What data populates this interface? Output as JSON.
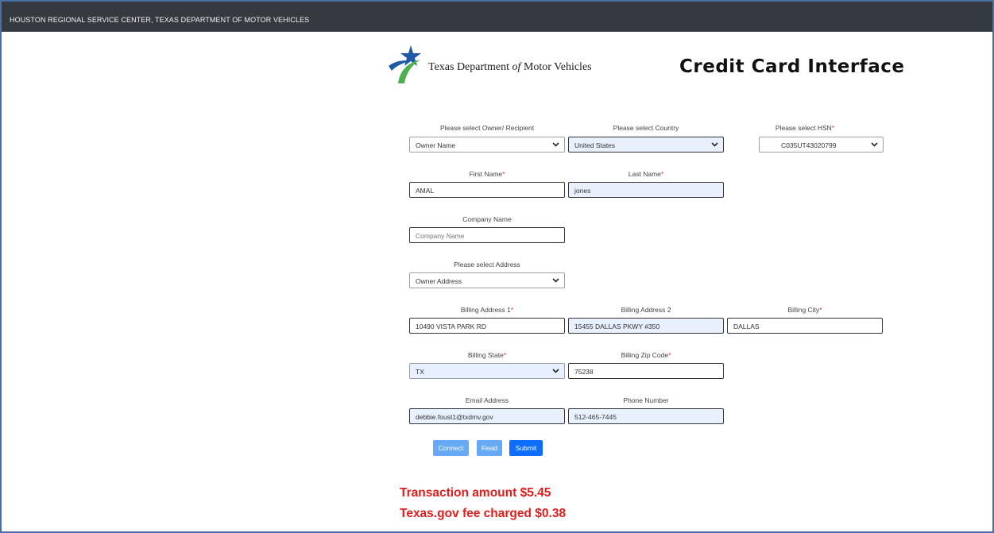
{
  "header": {
    "title": "HOUSTON REGIONAL SERVICE CENTER, TEXAS DEPARTMENT OF MOTOR VEHICLES"
  },
  "brand": {
    "logo_prefix": "Texas Department ",
    "logo_of": "of",
    "logo_suffix": " Motor Vehicles"
  },
  "page": {
    "title": "Credit Card Interface"
  },
  "form": {
    "owner": {
      "label": "Please select Owner/ Recipient",
      "value": "Owner Name"
    },
    "country": {
      "label": "Please select Country",
      "value": "United States"
    },
    "hsn": {
      "label": "Please select HSN",
      "value": "C035UT43020799"
    },
    "first_name": {
      "label": "First Name",
      "value": "AMAL"
    },
    "last_name": {
      "label": "Last Name",
      "value": "jones"
    },
    "company": {
      "label": "Company Name",
      "placeholder": "Company Name"
    },
    "address_select": {
      "label": "Please select Address",
      "value": "Owner Address"
    },
    "billing_address1": {
      "label": "Billing Address 1",
      "value": "10490 VISTA PARK RD"
    },
    "billing_address2": {
      "label": "Billing Address 2",
      "value": "15455 DALLAS PKWY #350"
    },
    "billing_city": {
      "label": "Billing City",
      "value": "DALLAS"
    },
    "billing_state": {
      "label": "Billing State",
      "value": "TX"
    },
    "billing_zip": {
      "label": "Billing Zip Code",
      "value": "75238"
    },
    "email": {
      "label": "Email Address",
      "value": "debbie.foust1@txdmv.gov"
    },
    "phone": {
      "label": "Phone Number",
      "value": "512-465-7445"
    },
    "required_mark": "*"
  },
  "buttons": {
    "connect": "Connect",
    "read": "Read",
    "submit": "Submit"
  },
  "notes": {
    "transaction": "Transaction amount $5.45",
    "fee": "Texas.gov fee charged $0.38"
  },
  "colors": {
    "accent": "#0d6efd",
    "alert": "#e21b1b",
    "header_bg": "#343a40",
    "logo_blue": "#1e5aa8",
    "logo_green": "#4caf50"
  }
}
